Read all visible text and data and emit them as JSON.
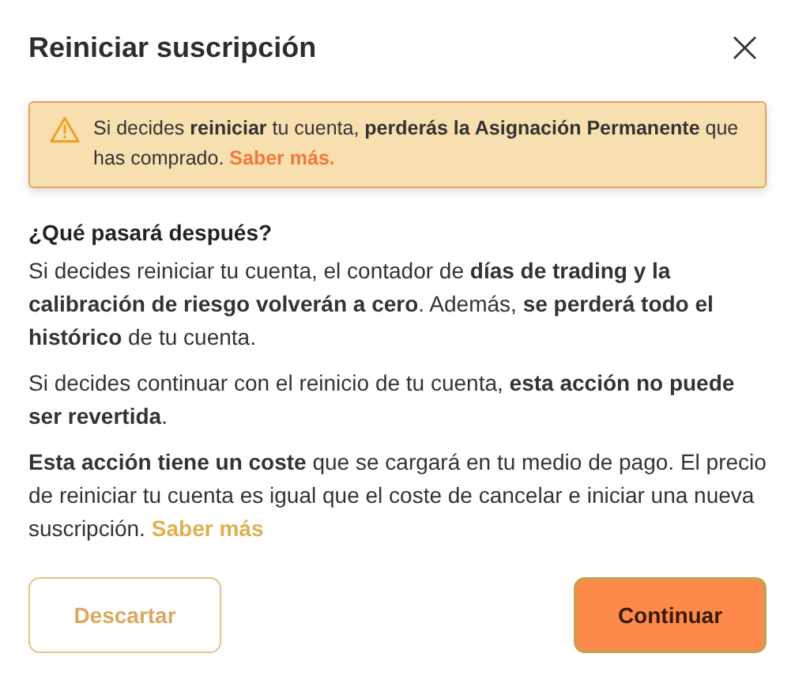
{
  "dialog": {
    "title": "Reiniciar suscripción",
    "close_label": "×"
  },
  "alert": {
    "text": "Si decides **reiniciar** tu cuenta, **perderás la Asignación Permanente** que has comprado.",
    "link": "Saber más."
  },
  "heading": "¿Qué pasará después?",
  "paragraphs": [
    {
      "text": "Si decides reiniciar tu cuenta, el contador de **días de trading y la calibración de riesgo volverán a cero**. Además, **se perderá todo el histórico** de tu cuenta."
    },
    {
      "text": "Si decides continuar con el reinicio de tu cuenta, **esta acción no puede ser revertida**."
    },
    {
      "text": "**Esta acción tiene un coste** que se cargará en tu medio de pago. El precio de reiniciar tu cuenta es igual que el coste de cancelar e iniciar una nueva suscripción.",
      "link": "Saber más"
    }
  ],
  "buttons": [
    {
      "label": "Descartar",
      "kind": "secondary"
    },
    {
      "label": "Continuar",
      "kind": "primary"
    }
  ]
}
